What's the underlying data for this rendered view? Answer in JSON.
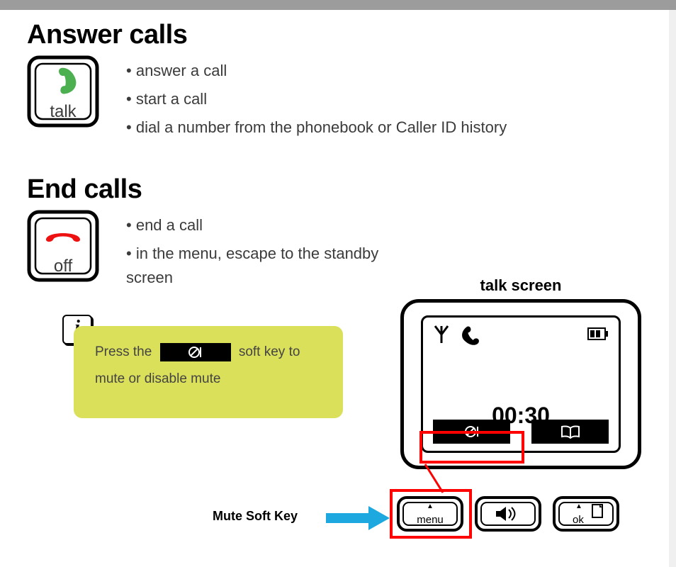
{
  "sections": {
    "answer": {
      "title": "Answer calls",
      "key_label": "talk",
      "bullets": [
        "answer a call",
        "start a call",
        "dial a number from the phonebook or Caller ID history"
      ]
    },
    "end": {
      "title": "End calls",
      "key_label": "off",
      "bullets": [
        "end a call",
        "in the menu, escape to the standby screen"
      ]
    }
  },
  "info_note": {
    "badge": "i",
    "pre_text": "Press the",
    "post_text": "soft key to",
    "line2": "mute or disable mute"
  },
  "figure": {
    "title": "talk screen",
    "timer": "00:30",
    "hw_keys": {
      "menu_label": "menu",
      "ok_label": "ok"
    },
    "callout_label": "Mute Soft Key"
  }
}
